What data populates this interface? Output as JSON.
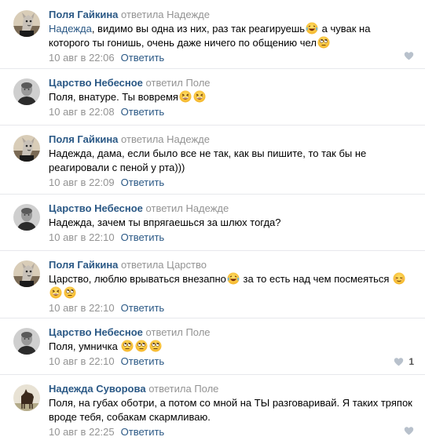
{
  "comments": [
    {
      "author": "Поля Гайкина",
      "action": "ответила",
      "target": "Надежде",
      "mention": "Надежда",
      "text": ", видимо вы одна из них, раз так реагируешь",
      "text2": " а чувак на которого ты гонишь, очень даже ничего по общению чел",
      "date": "10 авг в 22:06",
      "reply_label": "Ответить",
      "likes": ""
    },
    {
      "author": "Царство Небесное",
      "action": "ответил",
      "target": "Поле",
      "text": "Поля, внатуре. Ты вовремя",
      "date": "10 авг в 22:08",
      "reply_label": "Ответить",
      "likes": ""
    },
    {
      "author": "Поля Гайкина",
      "action": "ответила",
      "target": "Надежде",
      "text": "Надежда, дама, если было все не так, как вы пишите, то так бы не реагировали с пеной у рта)))",
      "date": "10 авг в 22:09",
      "reply_label": "Ответить",
      "likes": ""
    },
    {
      "author": "Царство Небесное",
      "action": "ответил",
      "target": "Надежде",
      "text": "Надежда, зачем ты впрягаешься за шлюх тогда?",
      "date": "10 авг в 22:10",
      "reply_label": "Ответить",
      "likes": ""
    },
    {
      "author": "Поля Гайкина",
      "action": "ответила",
      "target": "Царство",
      "text": "Царство, люблю врываться внезапно",
      "text2": " за то есть над чем посмеяться ",
      "date": "10 авг в 22:10",
      "reply_label": "Ответить",
      "likes": ""
    },
    {
      "author": "Царство Небесное",
      "action": "ответил",
      "target": "Поле",
      "text": "Поля, умничка ",
      "date": "10 авг в 22:10",
      "reply_label": "Ответить",
      "likes": "1"
    },
    {
      "author": "Надежда Суворова",
      "action": "ответила",
      "target": "Поле",
      "text": "Поля, на губах обoтри, а потом со мной на ТЫ разговаривай. Я таких тряпок вроде тебя, собакам скармливаю.",
      "date": "10 авг в 22:25",
      "reply_label": "Ответить",
      "likes": ""
    }
  ],
  "colors": {
    "link": "#2a5885",
    "muted": "#939393",
    "divider": "#e7e8ec",
    "like": "#b8c1cc"
  },
  "icons": {
    "like": "heart-icon",
    "emoji_laugh": "tears-of-joy-emoji",
    "emoji_grin": "grinning-squint-emoji",
    "emoji_roll": "rolling-eyes-emoji",
    "emoji_relieved": "relieved-emoji"
  }
}
